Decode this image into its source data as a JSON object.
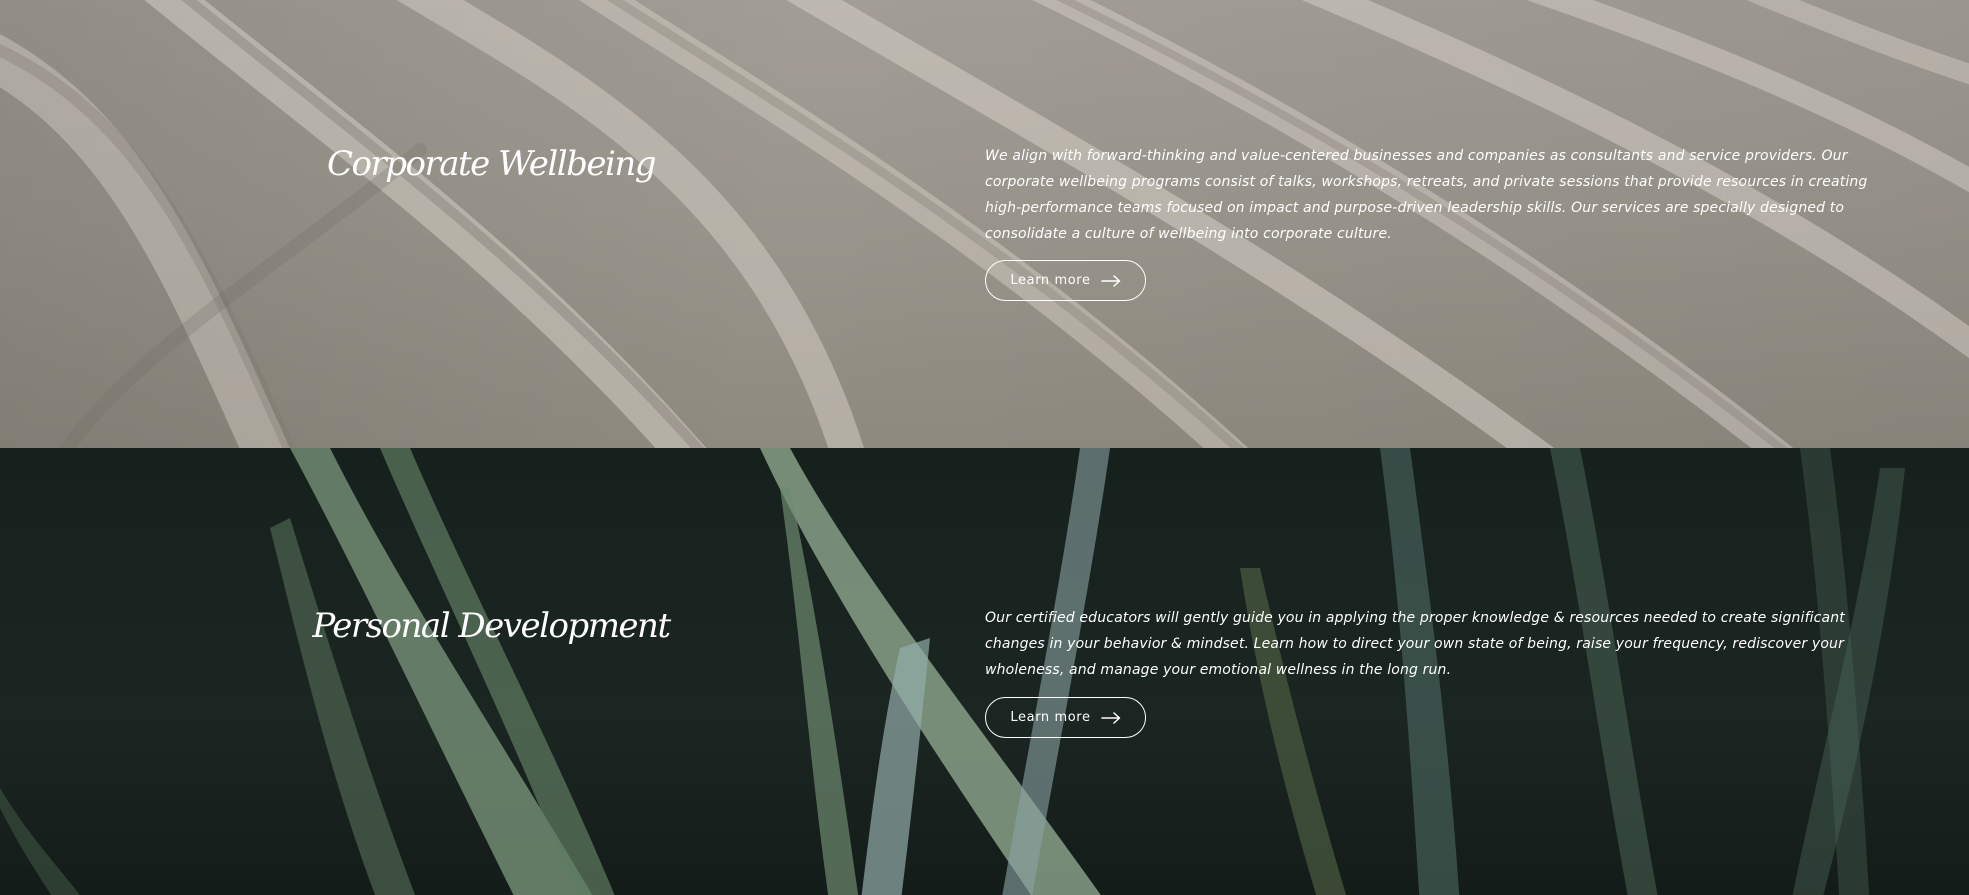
{
  "sections": [
    {
      "title": "Corporate Wellbeing",
      "body": "We align with forward-thinking and value-centered businesses and companies as consultants and service providers. Our corporate wellbeing programs consist of talks, workshops, retreats, and private sessions that provide resources in creating high-performance teams focused on impact and purpose-driven leadership skills. Our services are specially designed to consolidate a culture of wellbeing into corporate culture.",
      "button_label": "Learn more",
      "button_icon": "arrow-right-icon",
      "background": "sand-dunes"
    },
    {
      "title": "Personal Development",
      "body": "Our certified educators will gently guide you in applying the proper knowledge & resources needed to create significant changes in your behavior & mindset. Learn how to direct your own state of being, raise your frequency, rediscover your wholeness, and manage your emotional wellness in the long run.",
      "button_label": "Learn more",
      "button_icon": "arrow-right-icon",
      "background": "green-leaves"
    }
  ],
  "colors": {
    "text": "#ffffff",
    "sand": "#9d988f",
    "leaf_dark": "#18211d"
  }
}
